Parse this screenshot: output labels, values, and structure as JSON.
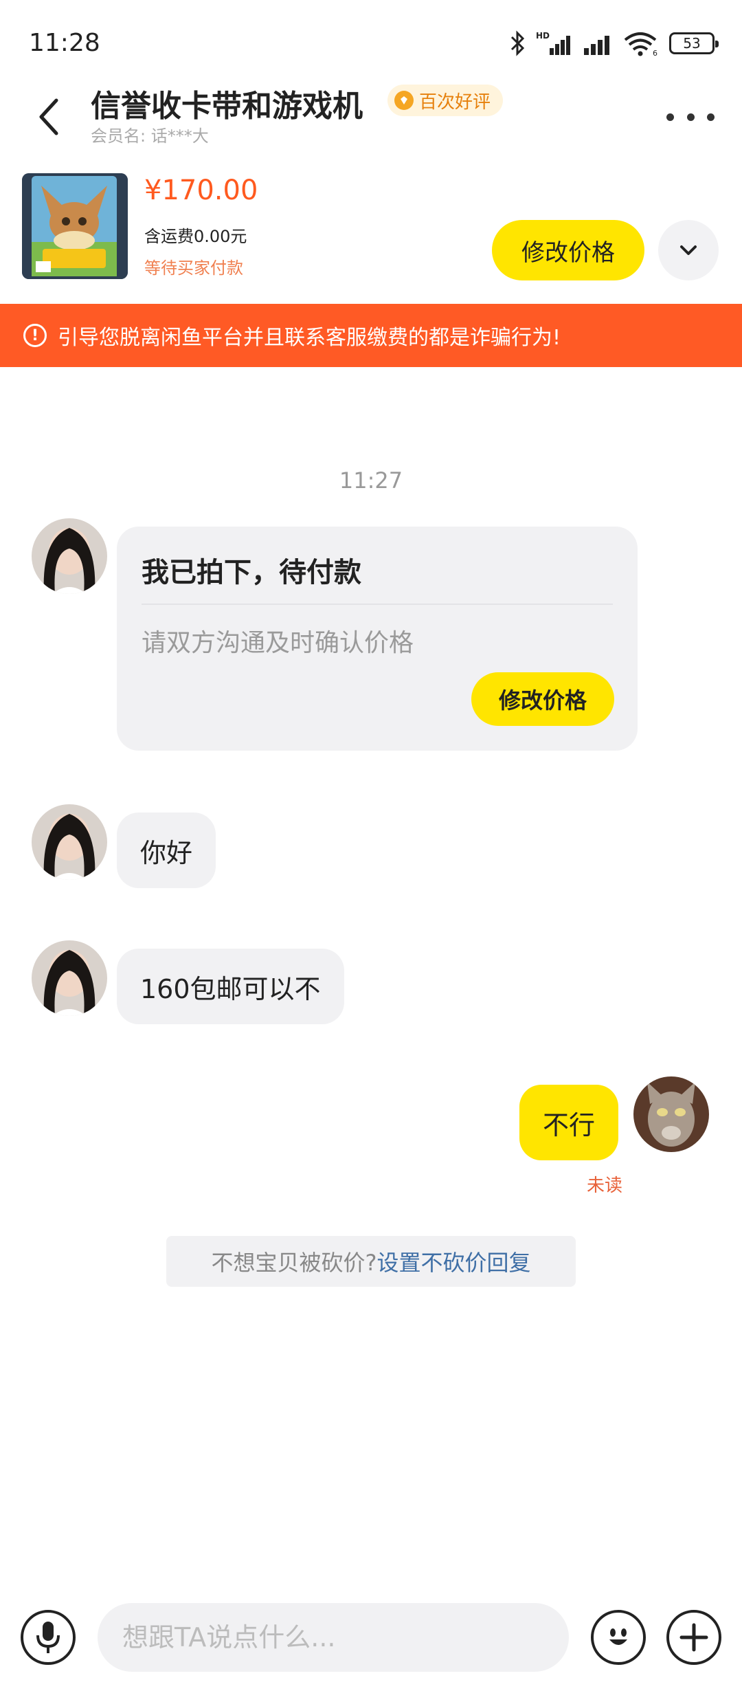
{
  "status_bar": {
    "time": "11:28",
    "battery": "53",
    "hd": "HD",
    "wifi_gen": "6"
  },
  "header": {
    "title": "信誉收卡带和游戏机",
    "badge": "百次好评",
    "member_label": "会员名: 话***大"
  },
  "product": {
    "price": "¥170.00",
    "shipping": "含运费0.00元",
    "status": "等待买家付款",
    "modify_label": "修改价格"
  },
  "warning": {
    "text": "引导您脱离闲鱼平台并且联系客服缴费的都是诈骗行为!"
  },
  "chat": {
    "timestamp": "11:27",
    "card": {
      "title": "我已拍下，待付款",
      "subtitle": "请双方沟通及时确认价格",
      "button": "修改价格"
    },
    "messages": [
      {
        "from": "buyer",
        "text": "你好"
      },
      {
        "from": "buyer",
        "text": "160包邮可以不"
      },
      {
        "from": "seller",
        "text": "不行"
      }
    ],
    "unread_label": "未读",
    "hint_text": "不想宝贝被砍价? ",
    "hint_link": "设置不砍价回复"
  },
  "input": {
    "placeholder": "想跟TA说点什么..."
  },
  "colors": {
    "accent_yellow": "#ffe500",
    "warning_orange": "#ff5a25",
    "price_orange": "#ff5a1f"
  }
}
